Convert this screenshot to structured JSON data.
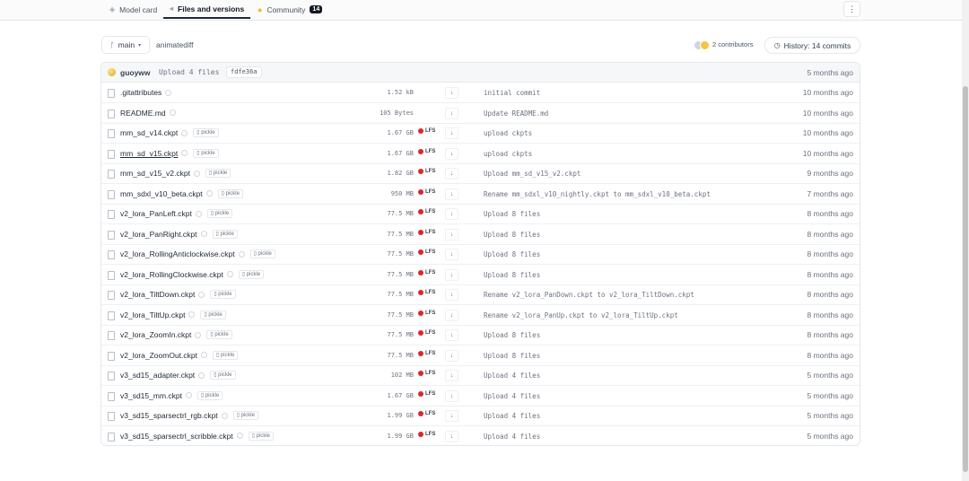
{
  "tabs": [
    {
      "label": "Model card",
      "icon": "model-card-icon",
      "active": false
    },
    {
      "label": "Files and versions",
      "icon": "files-icon",
      "active": true
    },
    {
      "label": "Community",
      "icon": "community-icon",
      "active": false,
      "badge": "14"
    }
  ],
  "more_label": "⋮",
  "branch": {
    "label": "main",
    "icon": "branch-icon"
  },
  "path": "animatediff",
  "contributors": {
    "label": "2 contributors"
  },
  "history": {
    "label": "History: 14 commits",
    "icon": "history-icon"
  },
  "last_commit": {
    "user": "guoyww",
    "message": "Upload 4 files",
    "hash": "fdfe36a",
    "time": "5 months ago"
  },
  "files": [
    {
      "name": ".gitattributes",
      "size": "1.52 kB",
      "lfs": false,
      "pickle": false,
      "commit": "initial commit",
      "time": "10 months ago"
    },
    {
      "name": "README.md",
      "size": "105 Bytes",
      "lfs": false,
      "pickle": false,
      "commit": "Update README.md",
      "time": "10 months ago"
    },
    {
      "name": "mm_sd_v14.ckpt",
      "size": "1.67 GB",
      "lfs": true,
      "pickle": true,
      "commit": "upload ckpts",
      "time": "10 months ago"
    },
    {
      "name": "mm_sd_v15.ckpt",
      "size": "1.67 GB",
      "lfs": true,
      "pickle": true,
      "commit": "upload ckpts",
      "time": "10 months ago",
      "underlined": true
    },
    {
      "name": "mm_sd_v15_v2.ckpt",
      "size": "1.82 GB",
      "lfs": true,
      "pickle": true,
      "commit": "Upload mm_sd_v15_v2.ckpt",
      "time": "9 months ago"
    },
    {
      "name": "mm_sdxl_v10_beta.ckpt",
      "size": "950 MB",
      "lfs": true,
      "pickle": true,
      "commit": "Rename mm_sdxl_v10_nightly.ckpt to mm_sdxl_v10_beta.ckpt",
      "time": "7 months ago"
    },
    {
      "name": "v2_lora_PanLeft.ckpt",
      "size": "77.5 MB",
      "lfs": true,
      "pickle": true,
      "commit": "Upload 8 files",
      "time": "8 months ago"
    },
    {
      "name": "v2_lora_PanRight.ckpt",
      "size": "77.5 MB",
      "lfs": true,
      "pickle": true,
      "commit": "Upload 8 files",
      "time": "8 months ago"
    },
    {
      "name": "v2_lora_RollingAnticlockwise.ckpt",
      "size": "77.5 MB",
      "lfs": true,
      "pickle": true,
      "commit": "Upload 8 files",
      "time": "8 months ago"
    },
    {
      "name": "v2_lora_RollingClockwise.ckpt",
      "size": "77.5 MB",
      "lfs": true,
      "pickle": true,
      "commit": "Upload 8 files",
      "time": "8 months ago"
    },
    {
      "name": "v2_lora_TiltDown.ckpt",
      "size": "77.5 MB",
      "lfs": true,
      "pickle": true,
      "commit": "Rename v2_lora_PanDown.ckpt to v2_lora_TiltDown.ckpt",
      "time": "8 months ago"
    },
    {
      "name": "v2_lora_TiltUp.ckpt",
      "size": "77.5 MB",
      "lfs": true,
      "pickle": true,
      "commit": "Rename v2_lora_PanUp.ckpt to v2_lora_TiltUp.ckpt",
      "time": "8 months ago"
    },
    {
      "name": "v2_lora_ZoomIn.ckpt",
      "size": "77.5 MB",
      "lfs": true,
      "pickle": true,
      "commit": "Upload 8 files",
      "time": "8 months ago"
    },
    {
      "name": "v2_lora_ZoomOut.ckpt",
      "size": "77.5 MB",
      "lfs": true,
      "pickle": true,
      "commit": "Upload 8 files",
      "time": "8 months ago"
    },
    {
      "name": "v3_sd15_adapter.ckpt",
      "size": "102 MB",
      "lfs": true,
      "pickle": true,
      "commit": "Upload 4 files",
      "time": "5 months ago"
    },
    {
      "name": "v3_sd15_mm.ckpt",
      "size": "1.67 GB",
      "lfs": true,
      "pickle": true,
      "commit": "Upload 4 files",
      "time": "5 months ago"
    },
    {
      "name": "v3_sd15_sparsectrl_rgb.ckpt",
      "size": "1.99 GB",
      "lfs": true,
      "pickle": true,
      "commit": "Upload 4 files",
      "time": "5 months ago"
    },
    {
      "name": "v3_sd15_sparsectrl_scribble.ckpt",
      "size": "1.99 GB",
      "lfs": true,
      "pickle": true,
      "commit": "Upload 4 files",
      "time": "5 months ago"
    }
  ],
  "labels": {
    "pickle": "pickle",
    "lfs": "LFS",
    "download_icon": "↓"
  },
  "colors": {
    "lfs": "#dc2626",
    "avatar": "#e5a623"
  }
}
